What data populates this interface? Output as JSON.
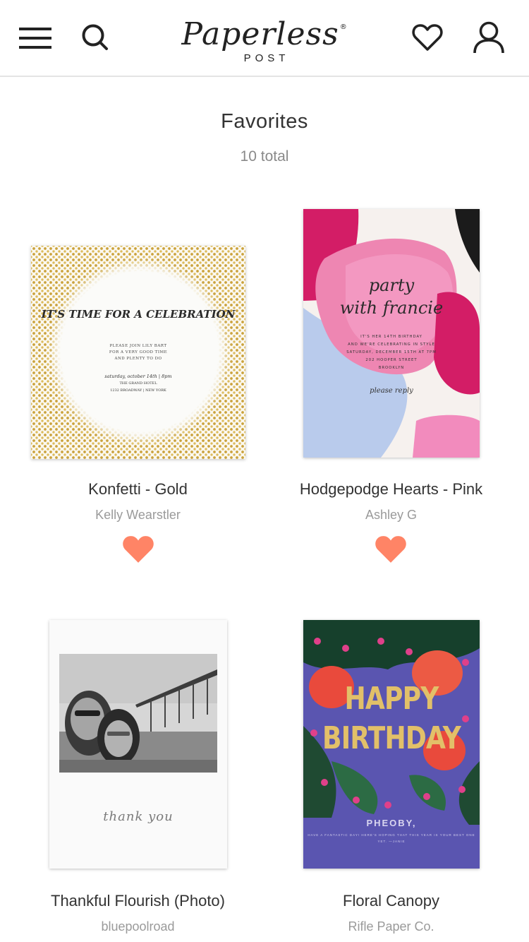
{
  "header": {
    "logo_script": "Paperless",
    "logo_registered": "®",
    "logo_sub": "POST",
    "icons": {
      "menu": "hamburger-menu-icon",
      "search": "search-icon",
      "favorites": "heart-outline-icon",
      "account": "user-icon"
    }
  },
  "page": {
    "title": "Favorites",
    "count": "10 total"
  },
  "colors": {
    "favorite_heart": "#ff8466",
    "text_primary": "#333333",
    "text_secondary": "#9a9a9a",
    "divider": "#e4e4e4"
  },
  "cards": [
    {
      "name": "Konfetti - Gold",
      "brand": "Kelly Wearstler",
      "favorited": true,
      "art": {
        "headline": "IT'S TIME FOR A CELEBRATION",
        "details": [
          "PLEASE JOIN LILY BART",
          "FOR A VERY GOOD TIME",
          "AND PLENTY TO DO"
        ],
        "event": [
          "saturday, october 14th | 8pm",
          "THE GRAND HOTEL",
          "1232 BROADWAY | NEW YORK"
        ]
      }
    },
    {
      "name": "Hodgepodge Hearts - Pink",
      "brand": "Ashley G",
      "favorited": true,
      "art": {
        "script_line1": "party",
        "script_line2": "with francie",
        "details": [
          "IT'S HER 14TH BIRTHDAY",
          "AND WE'RE CELEBRATING IN STYLE",
          "SATURDAY, DECEMBER 15TH AT 7PM",
          "202 HOOPER STREET",
          "BROOKLYN"
        ],
        "reply": "please reply"
      }
    },
    {
      "name": "Thankful Flourish (Photo)",
      "brand": "bluepoolroad",
      "art": {
        "signature": "thank you"
      }
    },
    {
      "name": "Floral Canopy",
      "brand": "Rifle Paper Co.",
      "art": {
        "headline_line1": "HAPPY",
        "headline_line2": "BIRTHDAY",
        "recipient": "PHEOBY,",
        "message": "HAVE A FANTASTIC DAY! HERE'S HOPING THAT THIS YEAR IS YOUR BEST ONE YET. —JANIE"
      }
    }
  ]
}
